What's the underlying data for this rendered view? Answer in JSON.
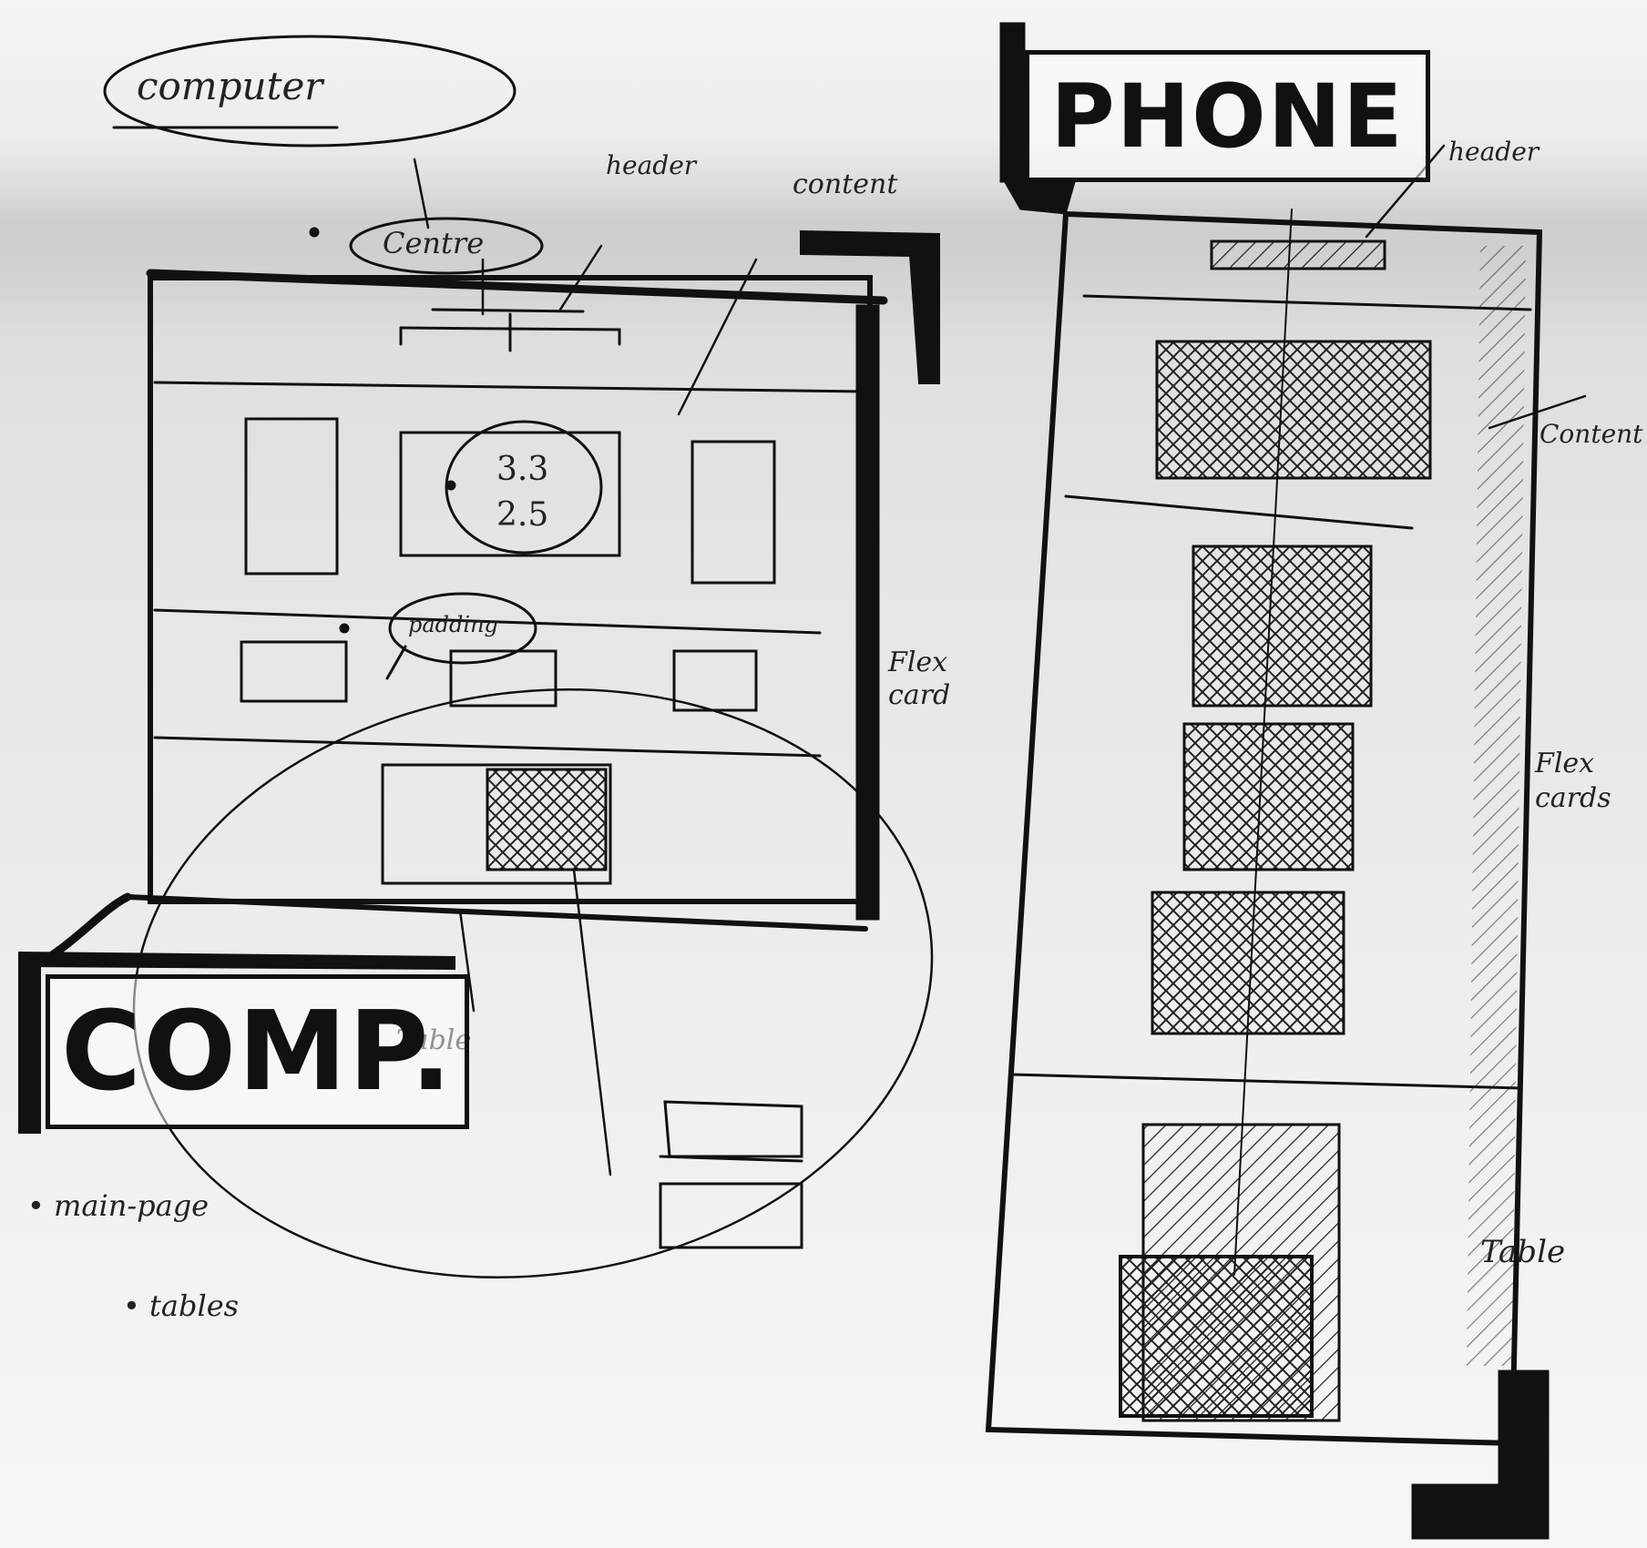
{
  "labels": {
    "computer": "computer",
    "centre": "Centre",
    "header": "header",
    "content": "content",
    "numbers_top": "3.3",
    "numbers_bottom": "2.5",
    "padding": "padding",
    "flex_cards_comp": "Flex card",
    "table_comp": "Table",
    "comp_title": "COMP.",
    "phone_title": "PHONE",
    "phone_header": "header",
    "phone_content": "Content",
    "phone_flex_cards": "Flex cards",
    "phone_table": "Table"
  },
  "notes": [
    "main-page",
    "tables"
  ]
}
